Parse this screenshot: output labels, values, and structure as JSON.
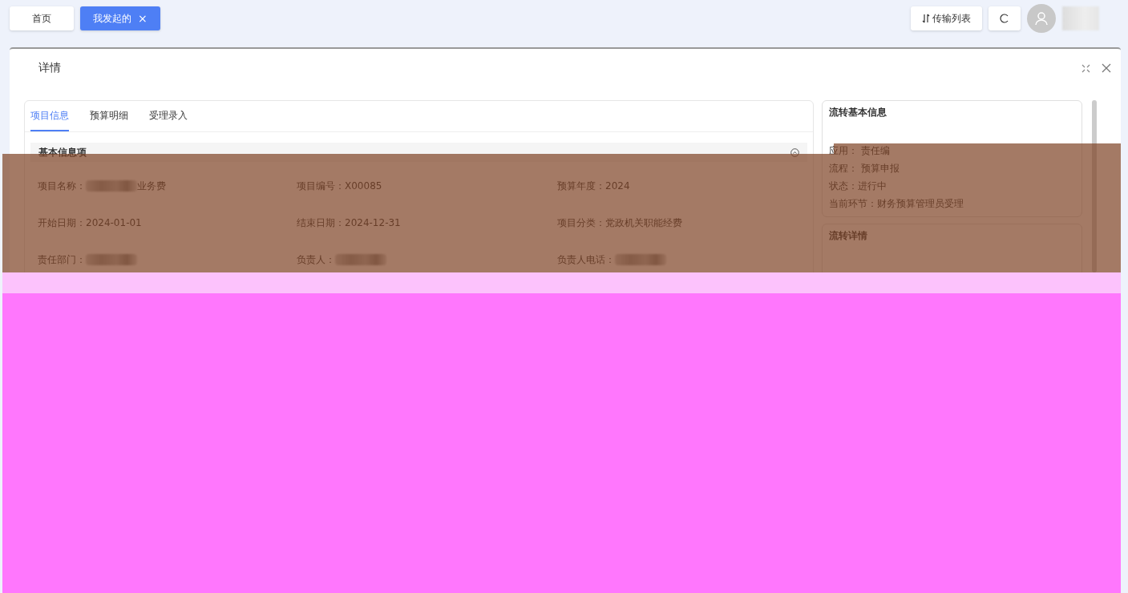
{
  "top_bar": {
    "tabs": [
      {
        "label": "首页",
        "selected": false,
        "closable": false
      },
      {
        "label": "我发起的",
        "selected": true,
        "closable": true
      }
    ],
    "close_glyph": "×",
    "transfer_button": "传输列表"
  },
  "dialog": {
    "title": "详情"
  },
  "detail_tabs": [
    {
      "label": "项目信息",
      "selected": true
    },
    {
      "label": "预算明细",
      "selected": false
    },
    {
      "label": "受理录入",
      "selected": false
    }
  ],
  "section": {
    "title": "基本信息项",
    "expanded": true
  },
  "fields": [
    {
      "label": "项目名称：",
      "value": "业务费",
      "redacted": true
    },
    {
      "label": "项目编号：",
      "value": "X00085",
      "redacted": false
    },
    {
      "label": "预算年度：",
      "value": "2024",
      "redacted": false
    },
    {
      "label": "开始日期：",
      "value": "2024-01-01",
      "redacted": false
    },
    {
      "label": "结束日期：",
      "value": "2024-12-31",
      "redacted": false
    },
    {
      "label": "项目分类：",
      "value": "党政机关职能经费",
      "redacted": false
    },
    {
      "label": "责任部门：",
      "redacted": true
    },
    {
      "label": "负责人：",
      "redacted": true
    },
    {
      "label": "负责人电话：",
      "redacted": true
    }
  ],
  "flow_info": {
    "title": "流转基本信息",
    "lines": [
      "应用： 责任编",
      "流程： 预算申报",
      "状态：进行中",
      "当前环节：财务预算管理员受理"
    ]
  },
  "flow_detail": {
    "title": "流转详情"
  }
}
